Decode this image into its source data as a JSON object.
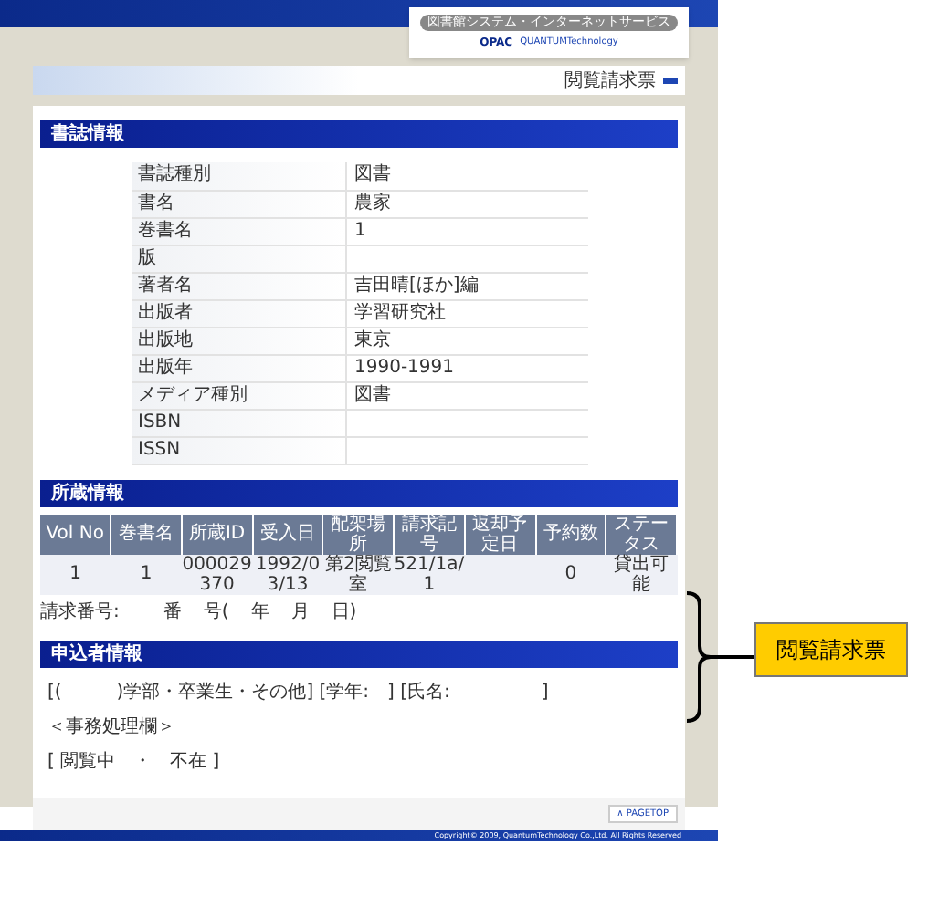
{
  "header": {
    "service_badge": "図書館システム・インターネットサービス",
    "logo_opac": "OPAC",
    "logo_company": "QUANTUMTechnology"
  },
  "page_title": "閲覧請求票",
  "bib_section": {
    "heading": "書誌情報",
    "rows": [
      {
        "label": "書誌種別",
        "value": "図書"
      },
      {
        "label": "書名",
        "value": "農家"
      },
      {
        "label": "巻書名",
        "value": "1"
      },
      {
        "label": "版",
        "value": ""
      },
      {
        "label": "著者名",
        "value": "吉田晴[ほか]編"
      },
      {
        "label": "出版者",
        "value": "学習研究社"
      },
      {
        "label": "出版地",
        "value": "東京"
      },
      {
        "label": "出版年",
        "value": "1990-1991"
      },
      {
        "label": "メディア種別",
        "value": "図書"
      },
      {
        "label": "ISBN",
        "value": ""
      },
      {
        "label": "ISSN",
        "value": ""
      }
    ]
  },
  "holdings_section": {
    "heading": "所蔵情報",
    "columns": [
      "Vol No",
      "巻書名",
      "所蔵ID",
      "受入日",
      "配架場所",
      "請求記号",
      "返却予定日",
      "予約数",
      "ステータス"
    ],
    "rows": [
      [
        "1",
        "1",
        "000029370",
        "1992/03/13",
        "第2閲覧室",
        "521/1a/1",
        "",
        "0",
        "貸出可能"
      ]
    ],
    "request_number": [
      "請求番号:",
      "番",
      "号(",
      "年",
      "月",
      "日)"
    ]
  },
  "applicant_section": {
    "heading": "申込者情報",
    "line": "[(　　　)学部・卒業生・その他] [学年:　] [氏名:　　　　　]",
    "office_label": "＜事務処理欄＞",
    "status_line": "[ 閲覧中　・　不在 ]"
  },
  "pagetop": "∧ PAGETOP",
  "footer": "Copyright© 2009, QuantumTechnology Co.,Ltd. All Rights Reserved",
  "callout": {
    "label": "閲覧請求票"
  }
}
